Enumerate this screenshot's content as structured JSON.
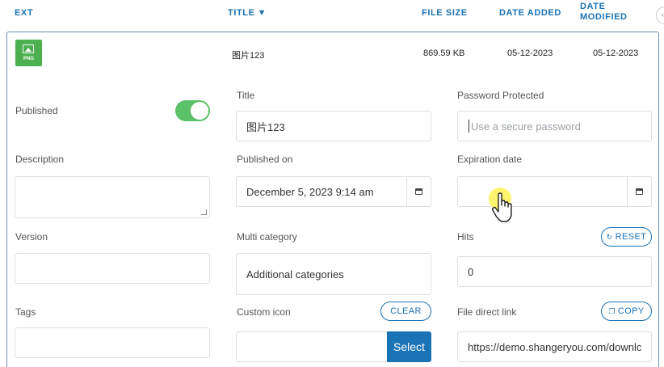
{
  "table_header": {
    "ext": "EXT",
    "title": "TITLE",
    "sort_indicator": "▼",
    "file_size": "FILE SIZE",
    "date_added": "DATE ADDED",
    "date_modified": "DATE MODIFIED"
  },
  "row": {
    "ext_icon": "png-file-icon",
    "ext_label": "PNG",
    "title": "图片123",
    "file_size": "869.59 KB",
    "date_added": "05-12-2023",
    "date_modified": "05-12-2023"
  },
  "form": {
    "published": {
      "label": "Published",
      "value": true
    },
    "title": {
      "label": "Title",
      "value": "图片123"
    },
    "password": {
      "label": "Password Protected",
      "placeholder": "Use a secure password"
    },
    "description": {
      "label": "Description",
      "value": ""
    },
    "published_on": {
      "label": "Published on",
      "value": "December 5, 2023 9:14 am"
    },
    "expiration": {
      "label": "Expiration date",
      "value": ""
    },
    "version": {
      "label": "Version",
      "value": ""
    },
    "multi_category": {
      "label": "Multi category",
      "placeholder": "Additional categories"
    },
    "hits": {
      "label": "Hits",
      "value": "0",
      "reset_label": "RESET"
    },
    "tags": {
      "label": "Tags",
      "value": ""
    },
    "custom_icon": {
      "label": "Custom icon",
      "clear_label": "CLEAR",
      "select_label": "Select"
    },
    "direct_link": {
      "label": "File direct link",
      "copy_label": "COPY",
      "value": "https://demo.shangeryou.com/downlc"
    }
  },
  "colors": {
    "accent": "#1a73b5",
    "toggle_on": "#5cc26a",
    "file_icon": "#4caf50"
  }
}
